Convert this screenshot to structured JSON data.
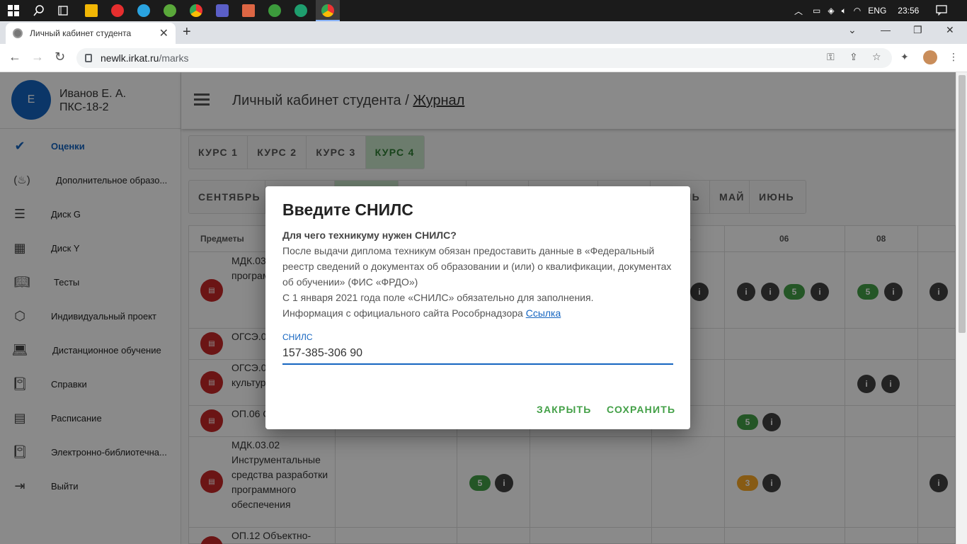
{
  "taskbar": {
    "language": "ENG",
    "time": "23:56"
  },
  "browser": {
    "tab_title": "Личный кабинет студента",
    "url_host": "newlk.irkat.ru",
    "url_path": "/marks"
  },
  "profile": {
    "initial": "Е",
    "name": "Иванов Е. А.",
    "group": "ПКС-18-2"
  },
  "sidebar": {
    "items": [
      {
        "label": "Оценки",
        "icon": "check-icon"
      },
      {
        "label": "Дополнительное образо...",
        "icon": "flame-icon"
      },
      {
        "label": "Диск G",
        "icon": "storage-icon"
      },
      {
        "label": "Диск Y",
        "icon": "building-icon"
      },
      {
        "label": "Тесты",
        "icon": "book-open-icon"
      },
      {
        "label": "Индивидуальный проект",
        "icon": "cube-icon"
      },
      {
        "label": "Дистанционное обучение",
        "icon": "laptop-icon"
      },
      {
        "label": "Справки",
        "icon": "book-icon"
      },
      {
        "label": "Расписание",
        "icon": "list-icon"
      },
      {
        "label": "Электронно-библиотечна...",
        "icon": "book-icon"
      },
      {
        "label": "Выйти",
        "icon": "exit-icon"
      }
    ]
  },
  "header": {
    "title_prefix": "Личный кабинет студента /",
    "title_link": "Журнал"
  },
  "courses": [
    "КУРС 1",
    "КУРС 2",
    "КУРС 3",
    "КУРС 4"
  ],
  "months": {
    "first": "СЕНТЯБРЬ",
    "partial": "ЛЬ",
    "may": "МАЙ",
    "june": "ИЮНЬ"
  },
  "table": {
    "subjects_header": "Предметы",
    "col_headers": [
      "5",
      "06",
      "08"
    ],
    "rows": [
      {
        "subject": "МДК.03 Технол разраб програм обеспеч"
      },
      {
        "subject": "ОГСЭ.0 филосо"
      },
      {
        "subject": "ОГСЭ.0 Физиче культур"
      },
      {
        "subject": "ОП.06 С экономи"
      },
      {
        "subject": "МДК.03.02 Инструментальные средства разработки программного обеспечения"
      },
      {
        "subject": "ОП.12 Объектно-"
      }
    ],
    "marks": {
      "five": "5",
      "three": "3"
    }
  },
  "dialog": {
    "title": "Введите СНИЛС",
    "question": "Для чего техникуму нужен СНИЛС?",
    "body_1": "После выдачи диплома техникум обязан предоставить данные в «Федеральный реестр сведений о документах об образовании и (или) о квалификации, документах об обучении» (ФИС «ФРДО»)",
    "body_2": "С 1 января 2021 года поле «СНИЛС» обязательно для заполнения.",
    "body_3": "Информация с официального сайта Рособрнадзора",
    "link": "Ссылка",
    "field_label": "СНИЛС",
    "field_value": "157-385-306 90",
    "close_label": "ЗАКРЫТЬ",
    "save_label": "СОХРАНИТЬ"
  }
}
